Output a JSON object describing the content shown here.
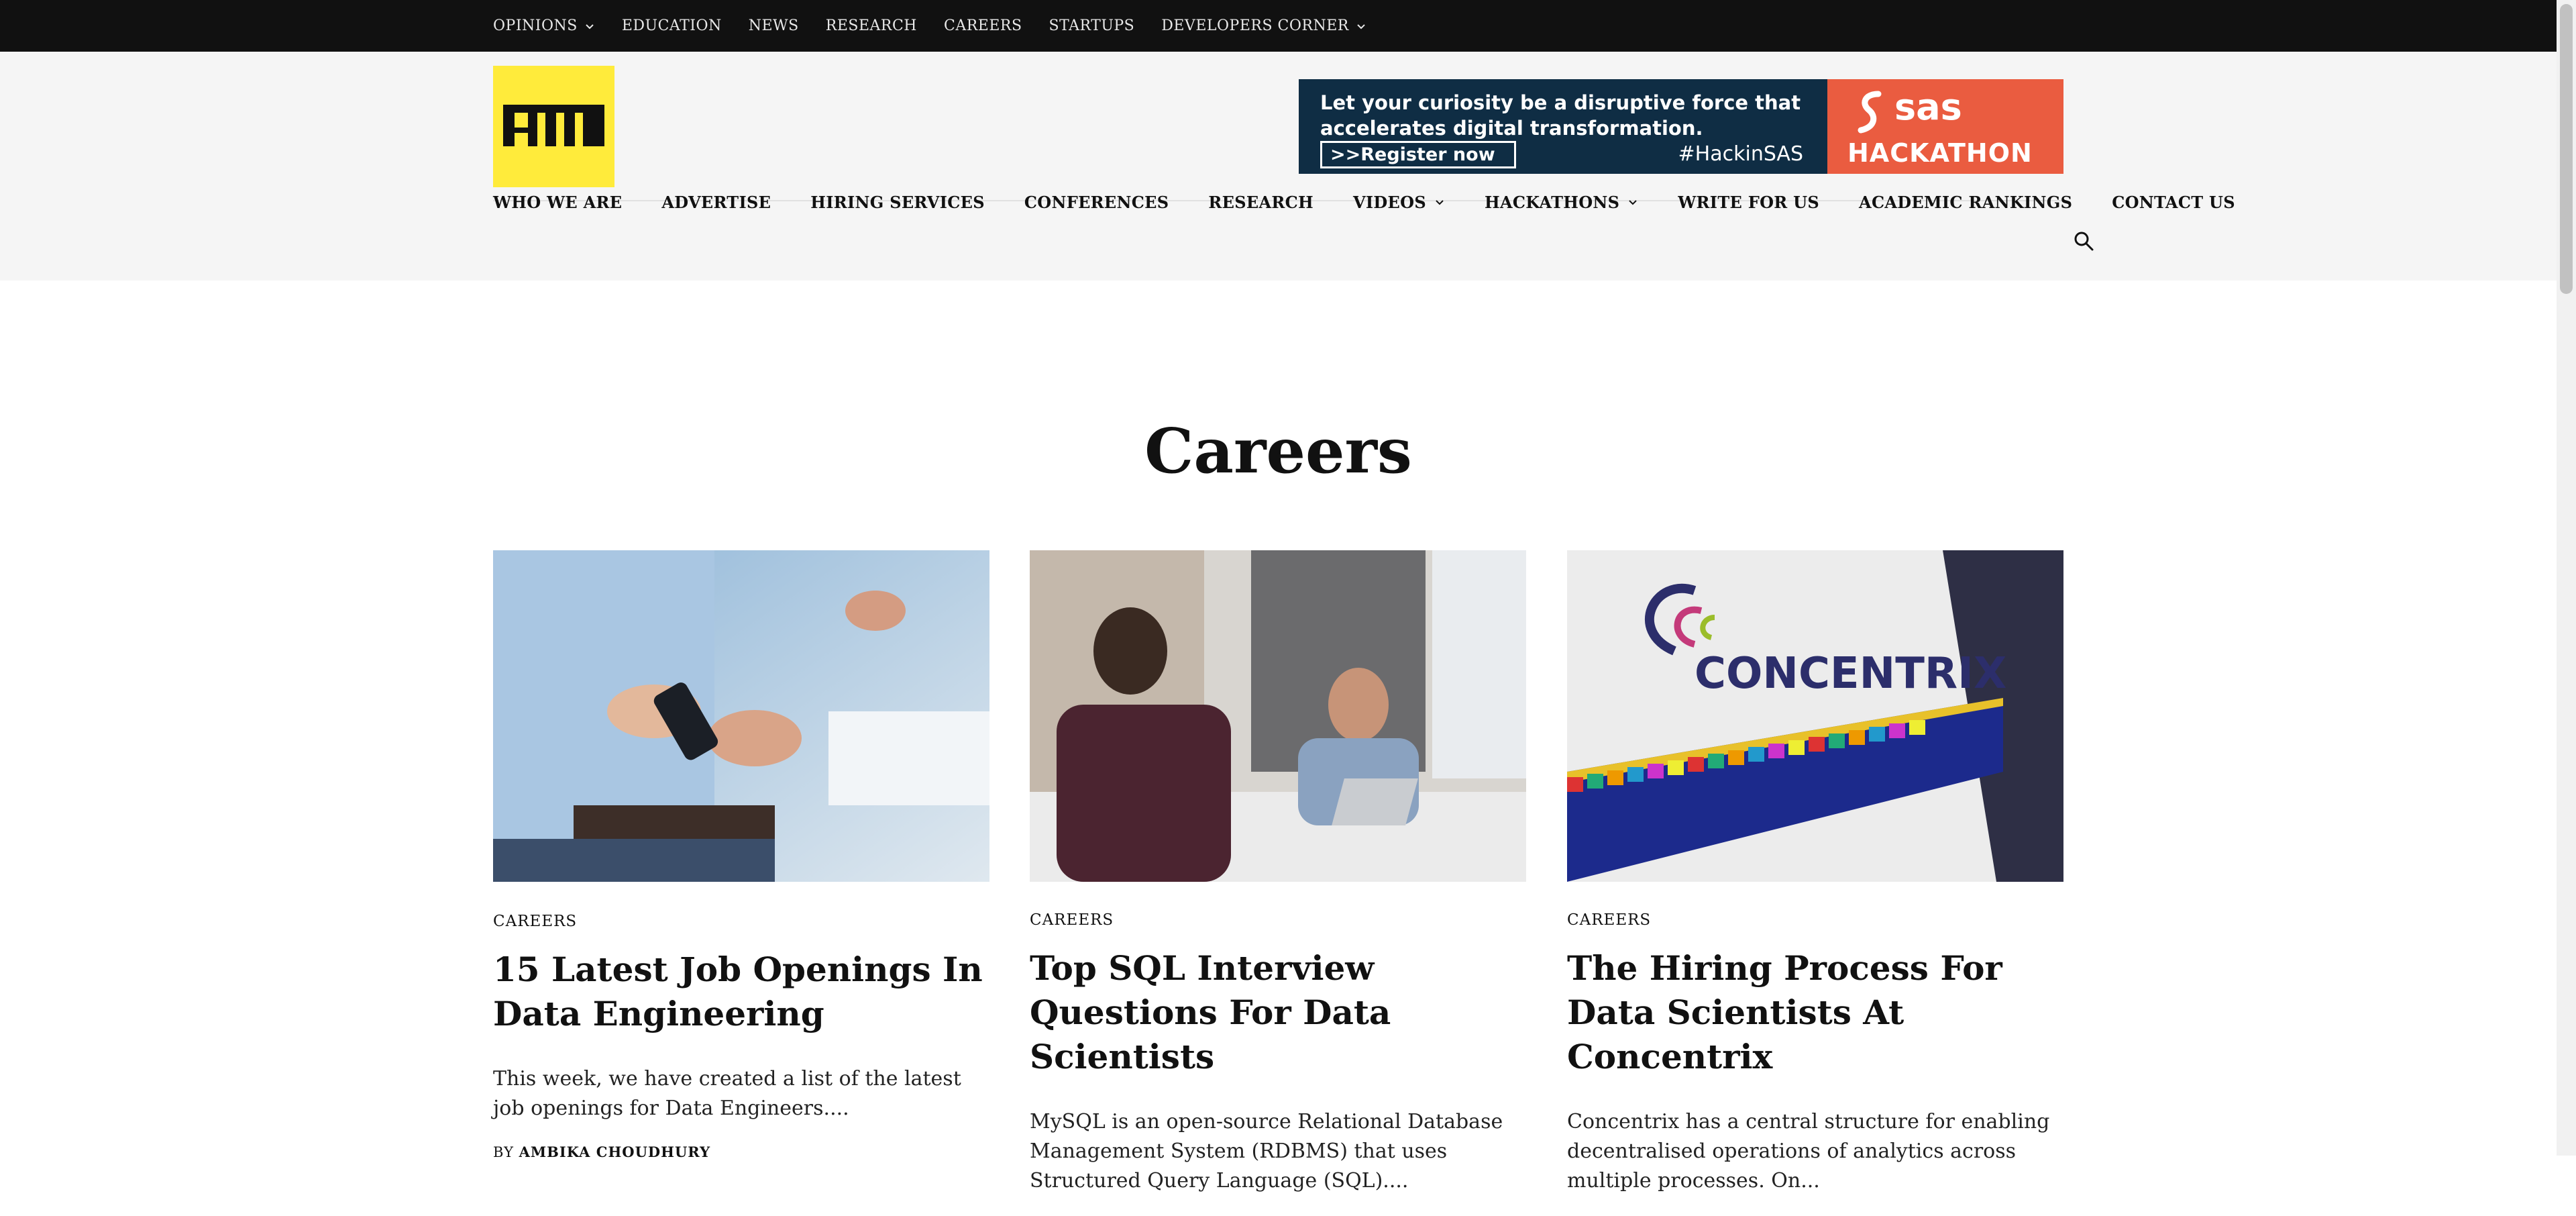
{
  "topnav": {
    "items": [
      {
        "label": "OPINIONS",
        "dropdown": true
      },
      {
        "label": "EDUCATION",
        "dropdown": false
      },
      {
        "label": "NEWS",
        "dropdown": false
      },
      {
        "label": "RESEARCH",
        "dropdown": false
      },
      {
        "label": "CAREERS",
        "dropdown": false
      },
      {
        "label": "STARTUPS",
        "dropdown": false
      },
      {
        "label": "DEVELOPERS CORNER",
        "dropdown": true
      }
    ]
  },
  "logo": {
    "text": "AIM",
    "bg_color": "#ffeb3b"
  },
  "banner": {
    "message": "Let your curiosity be a disruptive force that accelerates digital transformation.",
    "cta": ">>Register now",
    "hashtag": "#HackinSAS",
    "brand": "sas",
    "event": "HACKATHON"
  },
  "mainnav": {
    "items": [
      {
        "label": "WHO WE ARE",
        "dropdown": false
      },
      {
        "label": "ADVERTISE",
        "dropdown": false
      },
      {
        "label": "HIRING SERVICES",
        "dropdown": false
      },
      {
        "label": "CONFERENCES",
        "dropdown": false
      },
      {
        "label": "RESEARCH",
        "dropdown": false
      },
      {
        "label": "VIDEOS",
        "dropdown": true
      },
      {
        "label": "HACKATHONS",
        "dropdown": true
      },
      {
        "label": "WRITE FOR US",
        "dropdown": false
      },
      {
        "label": "ACADEMIC RANKINGS",
        "dropdown": false
      },
      {
        "label": "CONTACT US",
        "dropdown": false
      }
    ],
    "search_icon": "search-icon"
  },
  "page": {
    "title": "Careers"
  },
  "articles": [
    {
      "category": "CAREERS",
      "title": "15 Latest Job Openings In Data Engineering",
      "excerpt": "This week, we have created a list of the latest job openings for Data Engineers....",
      "by_prefix": "BY",
      "author": "AMBIKA CHOUDHURY"
    },
    {
      "category": "CAREERS",
      "title": "Top SQL Interview Questions For Data Scientists",
      "excerpt": "MySQL is an open-source Relational Database Management System (RDBMS) that uses Structured Query Language (SQL)....",
      "by_prefix": "",
      "author": ""
    },
    {
      "category": "CAREERS",
      "title": "The Hiring Process For Data Scientists At Concentrix",
      "excerpt": "Concentrix has a central structure for enabling decentralised operations of analytics across multiple processes. On...",
      "by_prefix": "",
      "author": "",
      "image_text": "CONCENTRIX"
    }
  ],
  "colors": {
    "topbar": "#111111",
    "header_bg": "#f5f5f5",
    "logo_yellow": "#ffeb3b",
    "banner_navy": "#0f2d44",
    "banner_orange": "#ea5c40"
  }
}
